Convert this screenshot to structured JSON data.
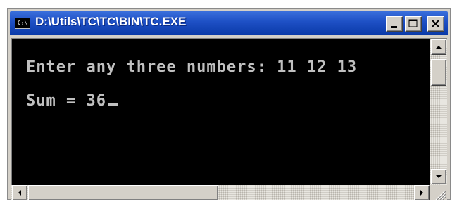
{
  "window": {
    "title": "D:\\Utils\\TC\\TC\\BIN\\TC.EXE",
    "app_icon_text": "C:\\"
  },
  "console": {
    "lines": [
      "Enter any three numbers: 11 12 13",
      "Sum = 36"
    ],
    "text_color": "#c0c0c0",
    "background_color": "#000000"
  },
  "colors": {
    "titlebar": "#1d4fc4",
    "chrome": "#d4d0c8"
  },
  "icons": {
    "minimize": "minimize-icon",
    "maximize": "maximize-icon",
    "close": "close-icon",
    "scroll_up": "arrow-up-icon",
    "scroll_down": "arrow-down-icon",
    "scroll_left": "arrow-left-icon",
    "scroll_right": "arrow-right-icon",
    "resize": "resize-grip-icon"
  }
}
